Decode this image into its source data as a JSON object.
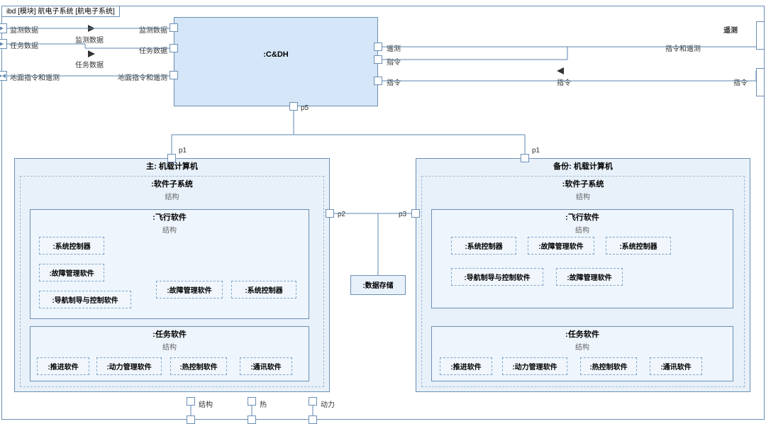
{
  "frame": {
    "title": "ibd [模块] 航电子系统 [航电子系统]"
  },
  "cdh": {
    "name": ":C&DH"
  },
  "left_ports": {
    "p1": "监测数据",
    "p2": "任务数据",
    "p3": "地面指令和遥测"
  },
  "cdh_left_labels": {
    "l1": "监测数据",
    "l2": "任务数据",
    "l3": "地面指令和遥测"
  },
  "flow_labels": {
    "monitor": "监测数据",
    "mission": "任务数据",
    "telemetry": "遥测",
    "command": "指令",
    "cmd_telemetry": "指令和遥测"
  },
  "right_port": {
    "label": "遥测"
  },
  "port_names": {
    "p1": "p1",
    "p2": "p2",
    "p3": "p3",
    "p5": "p5"
  },
  "primary": {
    "title": "主: 机载计算机",
    "sw_sub": ":软件子系统",
    "struct_label": "结构",
    "flight_sw": ":飞行软件",
    "mission_sw": ":任务软件",
    "parts_flight_left": [
      ":系统控制器",
      ":故障管理软件",
      ":导航制导与控制软件"
    ],
    "parts_flight_right": [
      ":故障管理软件",
      ":系统控制器"
    ],
    "parts_mission": [
      ":推进软件",
      ":动力管理软件",
      ":热控制软件",
      ":通讯软件"
    ]
  },
  "backup": {
    "title": "备份: 机载计算机",
    "sw_sub": ":软件子系统",
    "struct_label": "结构",
    "flight_sw": ":飞行软件",
    "mission_sw": ":任务软件",
    "parts_flight_row1": [
      ":系统控制器",
      ":故障管理软件",
      ":系统控制器"
    ],
    "parts_flight_row2": [
      ":导航制导与控制软件",
      ":故障管理软件"
    ],
    "parts_mission": [
      ":推进软件",
      ":动力管理软件",
      ":热控制软件",
      ":通讯软件"
    ]
  },
  "datastore": {
    "name": ":数据存储"
  },
  "bottom_ports": {
    "struct": "结构",
    "heat": "热",
    "power": "动力"
  }
}
